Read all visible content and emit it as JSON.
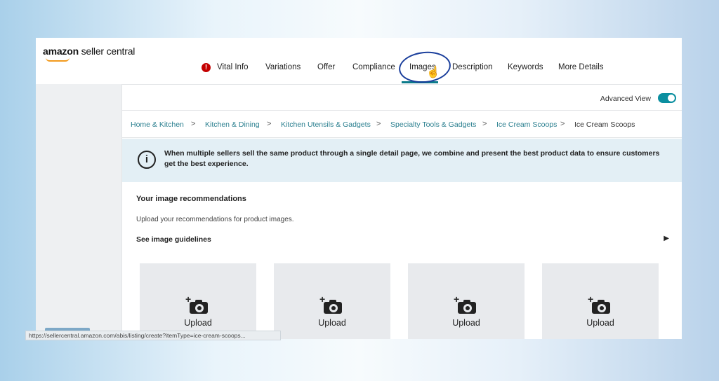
{
  "app": {
    "logo_brand": "amazon",
    "logo_product": " seller central"
  },
  "nav": {
    "alert_icon": "exclamation-icon",
    "tabs": [
      {
        "label": "Vital Info"
      },
      {
        "label": "Variations"
      },
      {
        "label": "Offer"
      },
      {
        "label": "Compliance"
      },
      {
        "label": "Images",
        "active": true
      },
      {
        "label": "Description"
      },
      {
        "label": "Keywords"
      },
      {
        "label": "More Details"
      }
    ]
  },
  "advanced_view": {
    "label": "Advanced View",
    "enabled": true
  },
  "breadcrumb": {
    "items": [
      "Home & Kitchen",
      "Kitchen & Dining",
      "Kitchen Utensils & Gadgets",
      "Specialty Tools & Gadgets",
      "Ice Cream Scoops",
      "Ice Cream Scoops"
    ],
    "separator": ">"
  },
  "banner": {
    "text": "When multiple sellers sell the same product through a single detail page, we combine and present the best product data to ensure customers get the best experience."
  },
  "images_section": {
    "title": "Your image recommendations",
    "description": "Upload your recommendations for product images.",
    "guidelines_link": "See image guidelines",
    "guidelines_arrow": "▶",
    "slots": [
      {
        "label": "Upload"
      },
      {
        "label": "Upload"
      },
      {
        "label": "Upload"
      },
      {
        "label": "Upload"
      }
    ]
  },
  "status_bar": {
    "url": "https://sellercentral.amazon.com/abis/listing/create?itemType=ice-cream-scoops..."
  },
  "colors": {
    "accent": "#0b7b8a",
    "alert": "#c40000",
    "banner_bg": "#e3eff5",
    "link": "#2a7f8f"
  }
}
